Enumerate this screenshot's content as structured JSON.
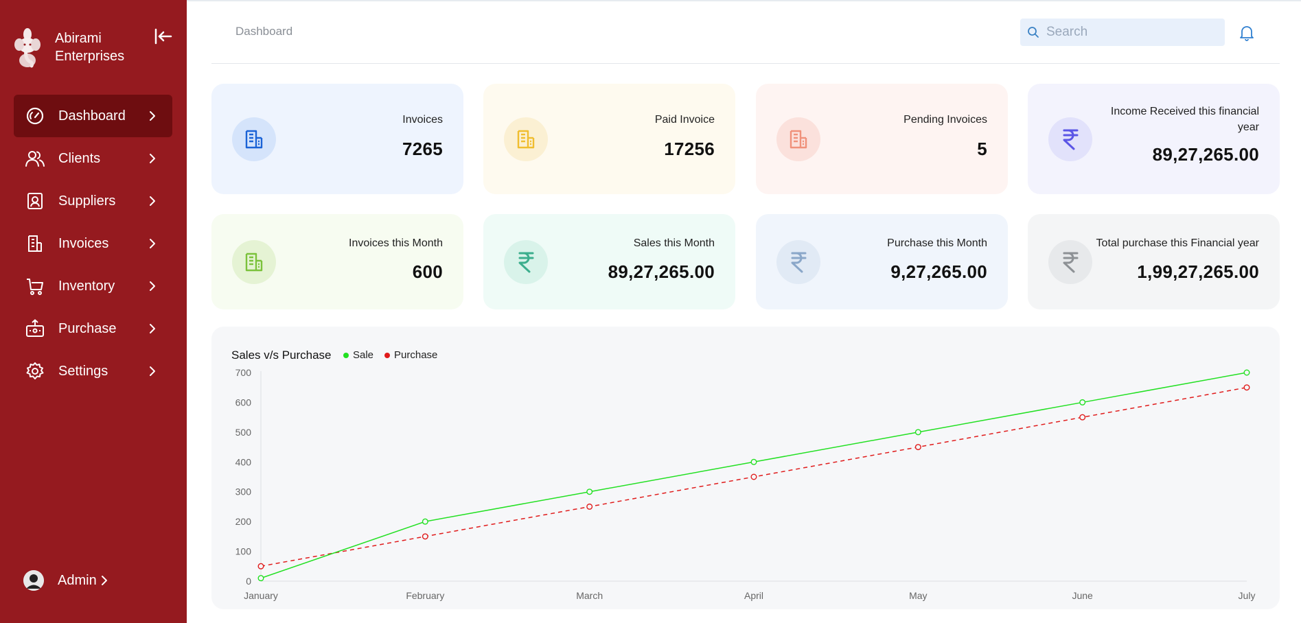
{
  "brand": {
    "name": "Abirami\nEnterprises"
  },
  "sidebar": {
    "items": [
      {
        "label": "Dashboard",
        "icon": "gauge-icon",
        "active": true
      },
      {
        "label": "Clients",
        "icon": "users-icon",
        "active": false
      },
      {
        "label": "Suppliers",
        "icon": "contact-card-icon",
        "active": false
      },
      {
        "label": "Invoices",
        "icon": "receipt-icon",
        "active": false
      },
      {
        "label": "Inventory",
        "icon": "cart-icon",
        "active": false
      },
      {
        "label": "Purchase",
        "icon": "purchase-box-icon",
        "active": false
      },
      {
        "label": "Settings",
        "icon": "gear-icon",
        "active": false
      }
    ],
    "user": {
      "label": "Admin"
    }
  },
  "header": {
    "breadcrumb": "Dashboard",
    "search_placeholder": "Search"
  },
  "stats": [
    {
      "label": "Invoices",
      "value": "7265",
      "icon": "building-receipt-icon",
      "bg": "#eef4fe",
      "circle": "#d5e4fb",
      "icon_color": "#1b63d6"
    },
    {
      "label": "Paid Invoice",
      "value": "17256",
      "icon": "building-receipt-icon",
      "bg": "#fefaef",
      "circle": "#fbf0d3",
      "icon_color": "#f0bd2f"
    },
    {
      "label": "Pending Invoices",
      "value": "5",
      "icon": "building-receipt-icon",
      "bg": "#fef4f2",
      "circle": "#fbe1dc",
      "icon_color": "#f0917a"
    },
    {
      "label": "Income Received this financial year",
      "value": "89,27,265.00",
      "icon": "rupee-icon",
      "bg": "#f3f3fd",
      "circle": "#e2e2fb",
      "icon_color": "#5b55e6"
    },
    {
      "label": "Invoices this Month",
      "value": "600",
      "icon": "building-receipt-icon",
      "bg": "#f7fcf1",
      "circle": "#e5f3d4",
      "icon_color": "#7bc23c"
    },
    {
      "label": "Sales this Month",
      "value": "89,27,265.00",
      "icon": "rupee-icon",
      "bg": "#effbf7",
      "circle": "#d9f3ea",
      "icon_color": "#3cae8d"
    },
    {
      "label": "Purchase this Month",
      "value": "9,27,265.00",
      "icon": "rupee-icon",
      "bg": "#f0f5fc",
      "circle": "#e1eaf5",
      "icon_color": "#8aa7c9"
    },
    {
      "label": "Total purchase this Financial year",
      "value": "1,99,27,265.00",
      "icon": "rupee-icon",
      "bg": "#f4f5f6",
      "circle": "#e7e9eb",
      "icon_color": "#8d9195"
    }
  ],
  "chart_data": {
    "type": "line",
    "title": "Sales v/s Purchase",
    "categories": [
      "January",
      "February",
      "March",
      "April",
      "May",
      "June",
      "July"
    ],
    "series": [
      {
        "name": "Sale",
        "color": "#22e022",
        "style": "solid",
        "values": [
          10,
          200,
          300,
          400,
          500,
          600,
          700
        ]
      },
      {
        "name": "Purchase",
        "color": "#e01b1b",
        "style": "dashed",
        "values": [
          50,
          150,
          250,
          350,
          450,
          550,
          650
        ]
      }
    ],
    "ylim": [
      0,
      700
    ],
    "yticks": [
      "0",
      "100",
      "200",
      "300",
      "400",
      "500",
      "600",
      "700"
    ],
    "xlabel": "",
    "ylabel": "",
    "legend": "top-left",
    "grid": false
  }
}
